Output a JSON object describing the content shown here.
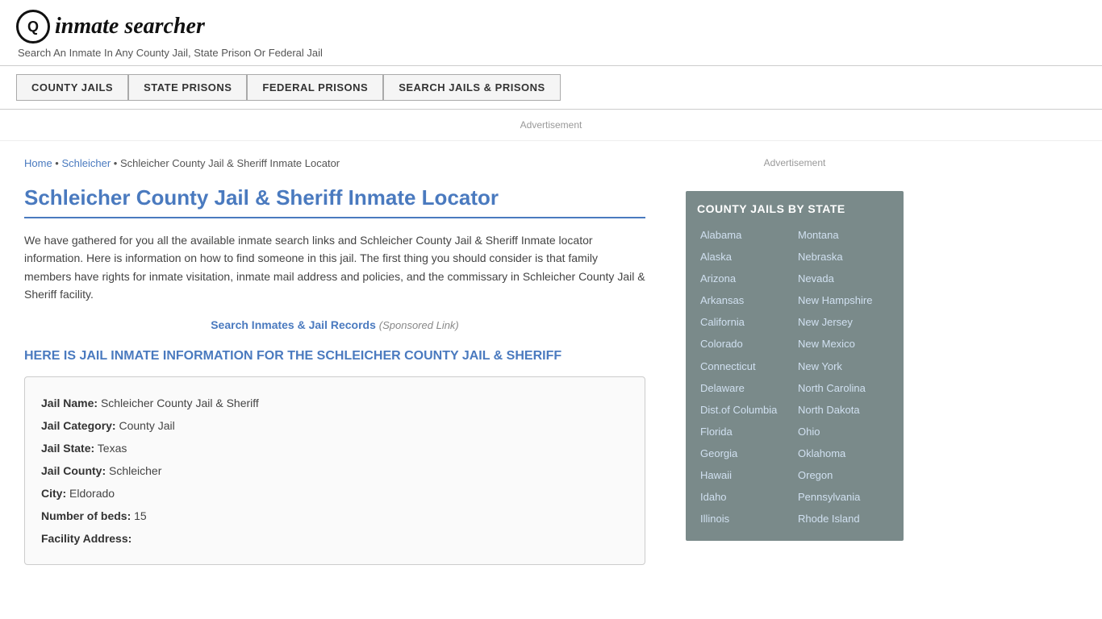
{
  "header": {
    "logo_icon": "Q",
    "logo_text": "inmate searcher",
    "tagline": "Search An Inmate In Any County Jail, State Prison Or Federal Jail"
  },
  "nav": {
    "items": [
      {
        "label": "COUNTY JAILS",
        "name": "county-jails-nav"
      },
      {
        "label": "STATE PRISONS",
        "name": "state-prisons-nav"
      },
      {
        "label": "FEDERAL PRISONS",
        "name": "federal-prisons-nav"
      },
      {
        "label": "SEARCH JAILS & PRISONS",
        "name": "search-jails-nav"
      }
    ]
  },
  "ad_label": "Advertisement",
  "breadcrumb": {
    "home": "Home",
    "parent": "Schleicher",
    "current": "Schleicher County Jail & Sheriff Inmate Locator"
  },
  "page_title": "Schleicher County Jail & Sheriff Inmate Locator",
  "description": "We have gathered for you all the available inmate search links and Schleicher County Jail & Sheriff Inmate locator information. Here is information on how to find someone in this jail. The first thing you should consider is that family members have rights for inmate visitation, inmate mail address and policies, and the commissary in Schleicher County Jail & Sheriff facility.",
  "search_link": {
    "text": "Search Inmates & Jail Records",
    "sponsored": "(Sponsored Link)"
  },
  "info_heading": "HERE IS JAIL INMATE INFORMATION FOR THE SCHLEICHER COUNTY JAIL & SHERIFF",
  "jail_info": {
    "name_label": "Jail Name:",
    "name_value": "Schleicher County Jail & Sheriff",
    "category_label": "Jail Category:",
    "category_value": "County Jail",
    "state_label": "Jail State:",
    "state_value": "Texas",
    "county_label": "Jail County:",
    "county_value": "Schleicher",
    "city_label": "City:",
    "city_value": "Eldorado",
    "beds_label": "Number of beds:",
    "beds_value": "15",
    "address_label": "Facility Address:"
  },
  "sidebar": {
    "ad_label": "Advertisement",
    "state_box_title": "COUNTY JAILS BY STATE",
    "states_col1": [
      "Alabama",
      "Alaska",
      "Arizona",
      "Arkansas",
      "California",
      "Colorado",
      "Connecticut",
      "Delaware",
      "Dist.of Columbia",
      "Florida",
      "Georgia",
      "Hawaii",
      "Idaho",
      "Illinois"
    ],
    "states_col2": [
      "Montana",
      "Nebraska",
      "Nevada",
      "New Hampshire",
      "New Jersey",
      "New Mexico",
      "New York",
      "North Carolina",
      "North Dakota",
      "Ohio",
      "Oklahoma",
      "Oregon",
      "Pennsylvania",
      "Rhode Island"
    ]
  }
}
